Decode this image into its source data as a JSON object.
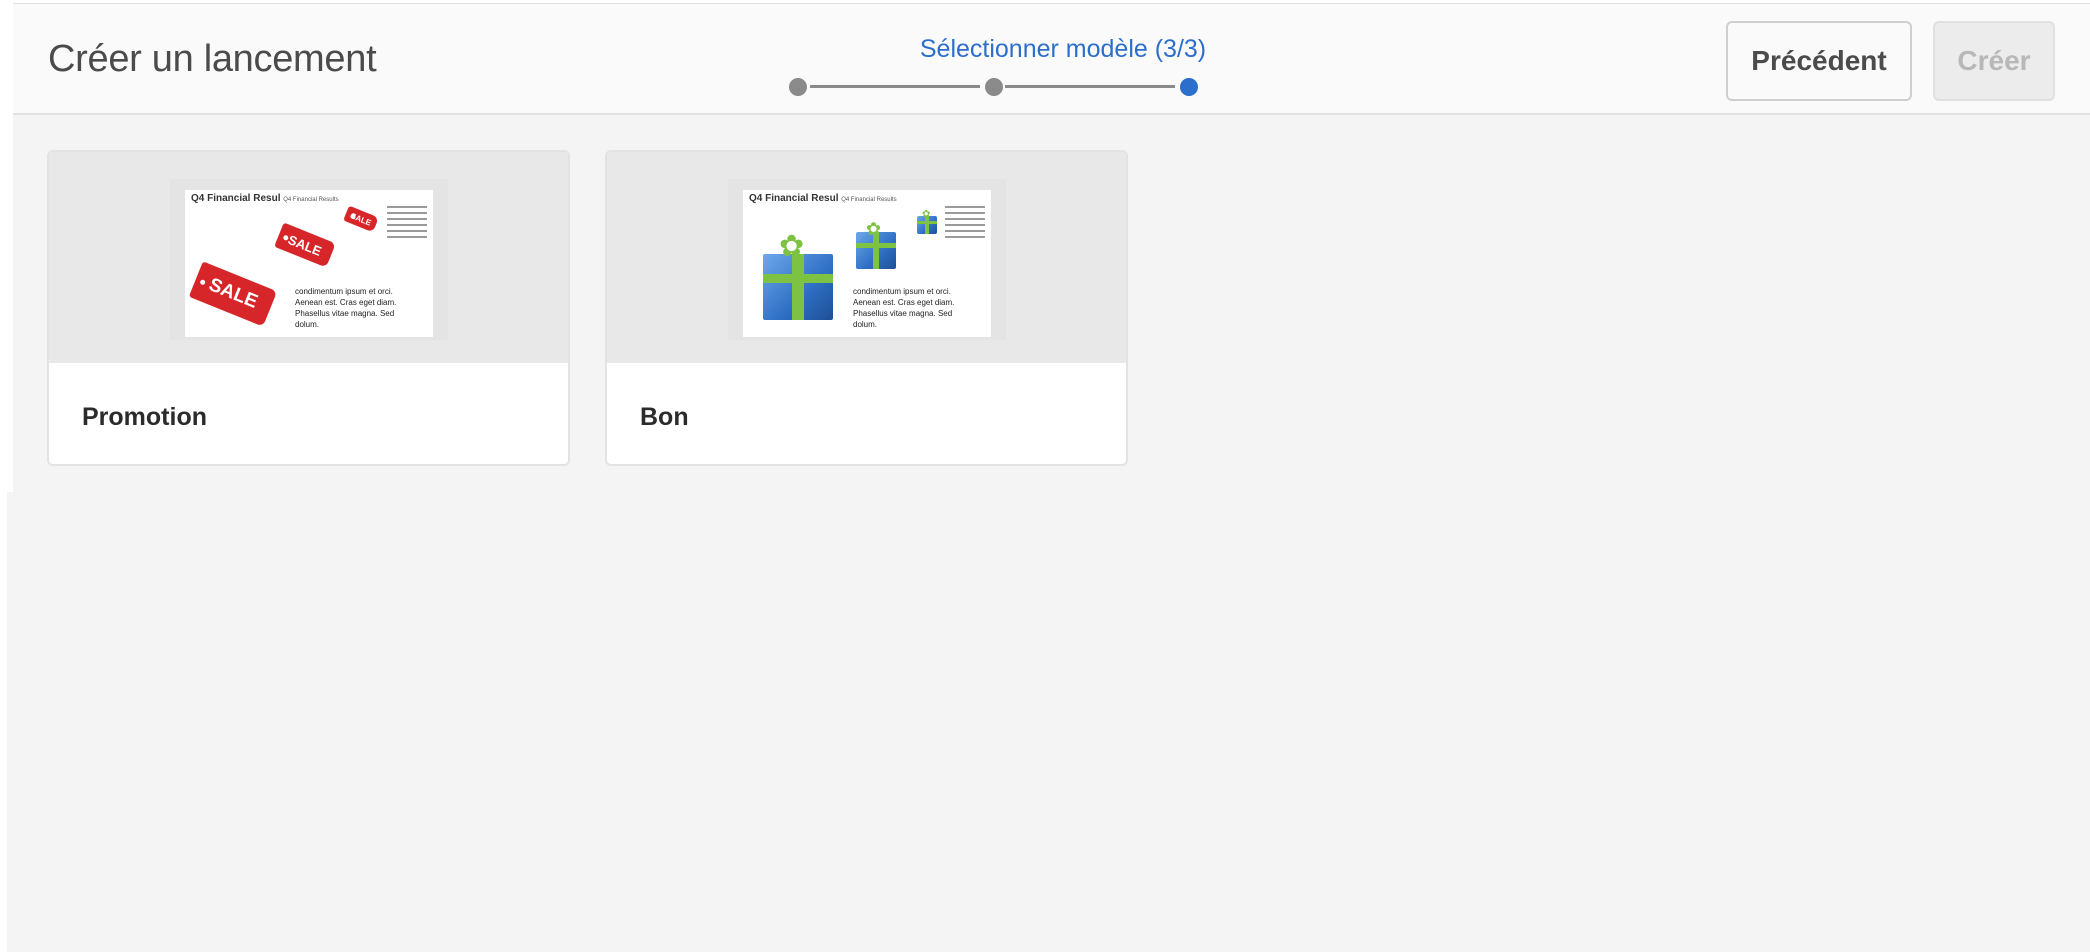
{
  "header": {
    "title": "Créer un lancement",
    "wizard": {
      "step_label": "Sélectionner modèle (3/3)",
      "current_step": 3,
      "total_steps": 3
    },
    "buttons": {
      "previous_label": "Précédent",
      "create_label": "Créer"
    },
    "colors": {
      "accent": "#2c6ecb",
      "inactive_step": "#8a8a8a"
    }
  },
  "templates": [
    {
      "label": "Promotion",
      "thumbnail": {
        "heading": "Q4 Financial Resul",
        "subheading": "Q4 Financial Results",
        "tag_text": "SALE",
        "body": "condimentum ipsum et orci. Aenean est. Cras eget diam. Phasellus vitae magna. Sed dolum."
      }
    },
    {
      "label": "Bon",
      "thumbnail": {
        "heading": "Q4 Financial Resul",
        "subheading": "Q4 Financial Results",
        "body": "condimentum ipsum et orci. Aenean est. Cras eget diam. Phasellus vitae magna. Sed dolum."
      }
    }
  ]
}
